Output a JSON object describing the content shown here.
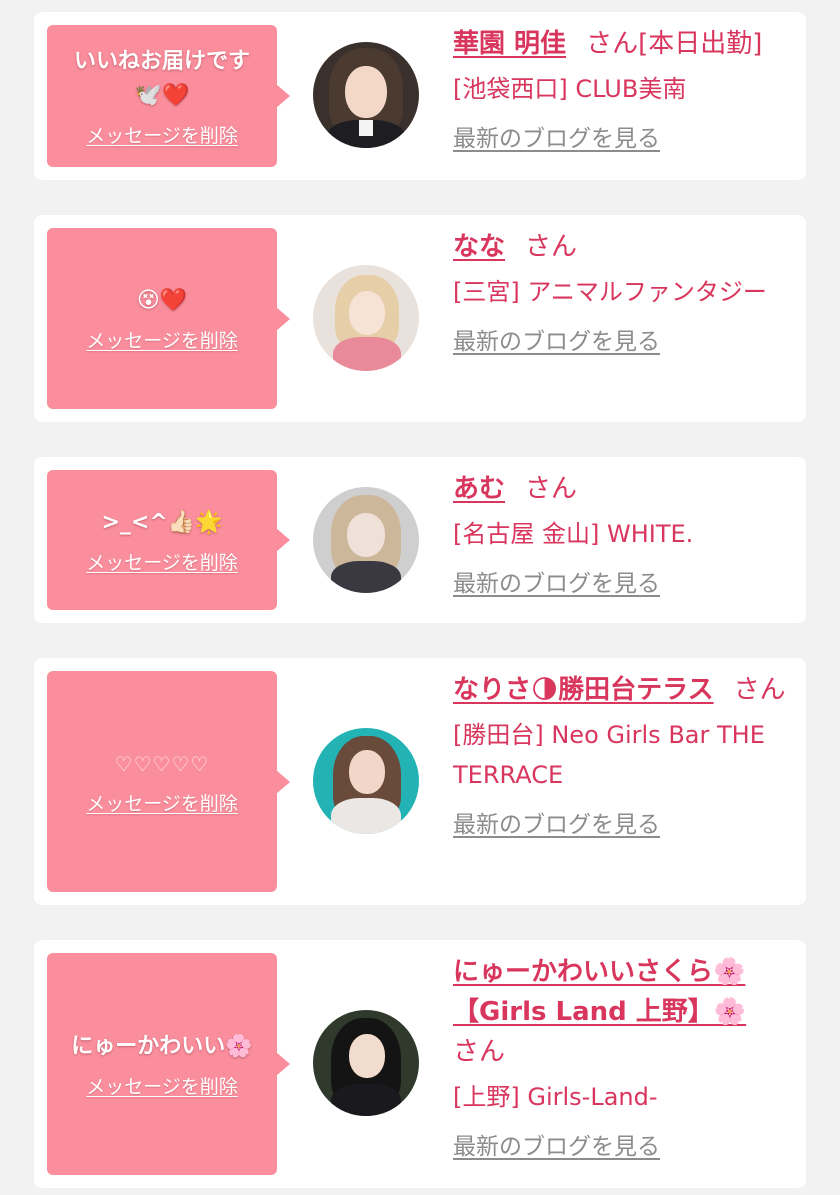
{
  "colors": {
    "background": "#f2f2f2",
    "card": "#ffffff",
    "bubble": "#fb8e9c",
    "accent": "#d9365e",
    "link_gray": "#8c8c8c"
  },
  "cards": [
    {
      "message": "いいねお届けです\n🕊️❤️",
      "delete_label": "メッセージを削除",
      "name": "華園 明佳",
      "honorific": "さん",
      "shop": "[池袋西口] CLUB美南",
      "tag": "[本日出勤]",
      "blog_link": "最新のブログを見る"
    },
    {
      "message": "😵❤️",
      "delete_label": "メッセージを削除",
      "name": "なな",
      "honorific": "さん",
      "shop": "[三宮] アニマルファンタジー",
      "blog_link": "最新のブログを見る"
    },
    {
      "message": ">_<^👍🏻🌟",
      "delete_label": "メッセージを削除",
      "name": "あむ",
      "honorific": "さん",
      "shop": "[名古屋 金山] WHITE.",
      "blog_link": "最新のブログを見る"
    },
    {
      "message": "♡♡♡♡♡",
      "delete_label": "メッセージを削除",
      "name": "なりさ🌗勝田台テラス",
      "honorific": "さん",
      "shop": "[勝田台] Neo Girls Bar THE TERRACE",
      "blog_link": "最新のブログを見る"
    },
    {
      "message": "にゅーかわいい🌸",
      "delete_label": "メッセージを削除",
      "name": "にゅーかわいいさくら🌸【Girls Land 上野】🌸",
      "honorific": "さん",
      "shop": "[上野] Girls-Land-",
      "blog_link": "最新のブログを見る"
    }
  ]
}
